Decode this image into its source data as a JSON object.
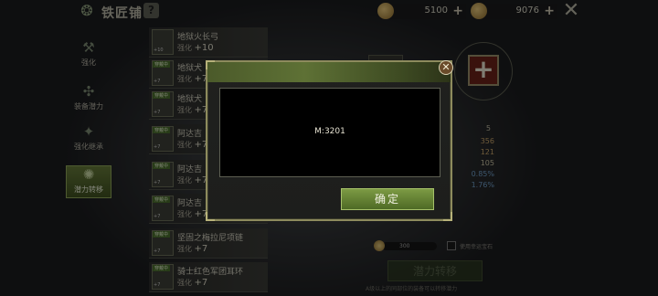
{
  "header": {
    "title": "铁匠铺",
    "help_icon": "?",
    "currency": [
      {
        "icon": "gold-coin-icon",
        "value": "5100"
      },
      {
        "icon": "coin-icon",
        "value": "9076"
      }
    ],
    "plus": "+",
    "close": "✕"
  },
  "nav": [
    {
      "label": "强化",
      "icon": "hammer-icon"
    },
    {
      "label": "装备潜力",
      "icon": "potential-icon"
    },
    {
      "label": "强化继承",
      "icon": "inherit-icon"
    },
    {
      "label": "潜力转移",
      "icon": "transfer-icon",
      "active": true
    }
  ],
  "items": [
    {
      "name": "地狱火长弓",
      "badge": "",
      "level": "+10",
      "enhance_label": "强化",
      "enhance": "+10"
    },
    {
      "name": "地狱犬",
      "badge": "穿戴中",
      "level": "+7",
      "enhance_label": "强化",
      "enhance": "+7"
    },
    {
      "name": "地狱犬",
      "badge": "穿戴中",
      "level": "+7",
      "enhance_label": "强化",
      "enhance": "+7"
    },
    {
      "name": "阿达吉",
      "badge": "穿戴中",
      "level": "+7",
      "enhance_label": "强化",
      "enhance": "+7"
    },
    {
      "name": "阿达吉",
      "badge": "穿戴中",
      "level": "+7",
      "enhance_label": "强化",
      "enhance": "+7"
    },
    {
      "name": "阿达吉",
      "badge": "穿戴中",
      "level": "+7",
      "enhance_label": "强化",
      "enhance": "+7"
    },
    {
      "name": "坚固之梅拉尼项链",
      "badge": "穿戴中",
      "level": "+7",
      "enhance_label": "强化",
      "enhance": "+7"
    },
    {
      "name": "骑士红色军团耳环",
      "badge": "穿戴中",
      "level": "+7",
      "enhance_label": "强化",
      "enhance": "+7"
    }
  ],
  "stats": [
    {
      "value": "356",
      "color": "#c9a46a"
    },
    {
      "value": "121",
      "color": "#c9a46a"
    },
    {
      "value": "105",
      "color": "#c9c2a2"
    },
    {
      "value": "0.85%",
      "color": "#6f9ec9"
    },
    {
      "value": "1.76%",
      "color": "#6f9ec9"
    }
  ],
  "stat_header": "5",
  "slider_value": "300",
  "checkbox_label": "使用幸运宝石",
  "transfer_button": "潜力转移",
  "footnote": "A级以上的同部位的装备可以转移潜力",
  "add_icon": "+",
  "dialog": {
    "message": "M:3201",
    "confirm_label": "确定",
    "close_icon": "✕"
  }
}
